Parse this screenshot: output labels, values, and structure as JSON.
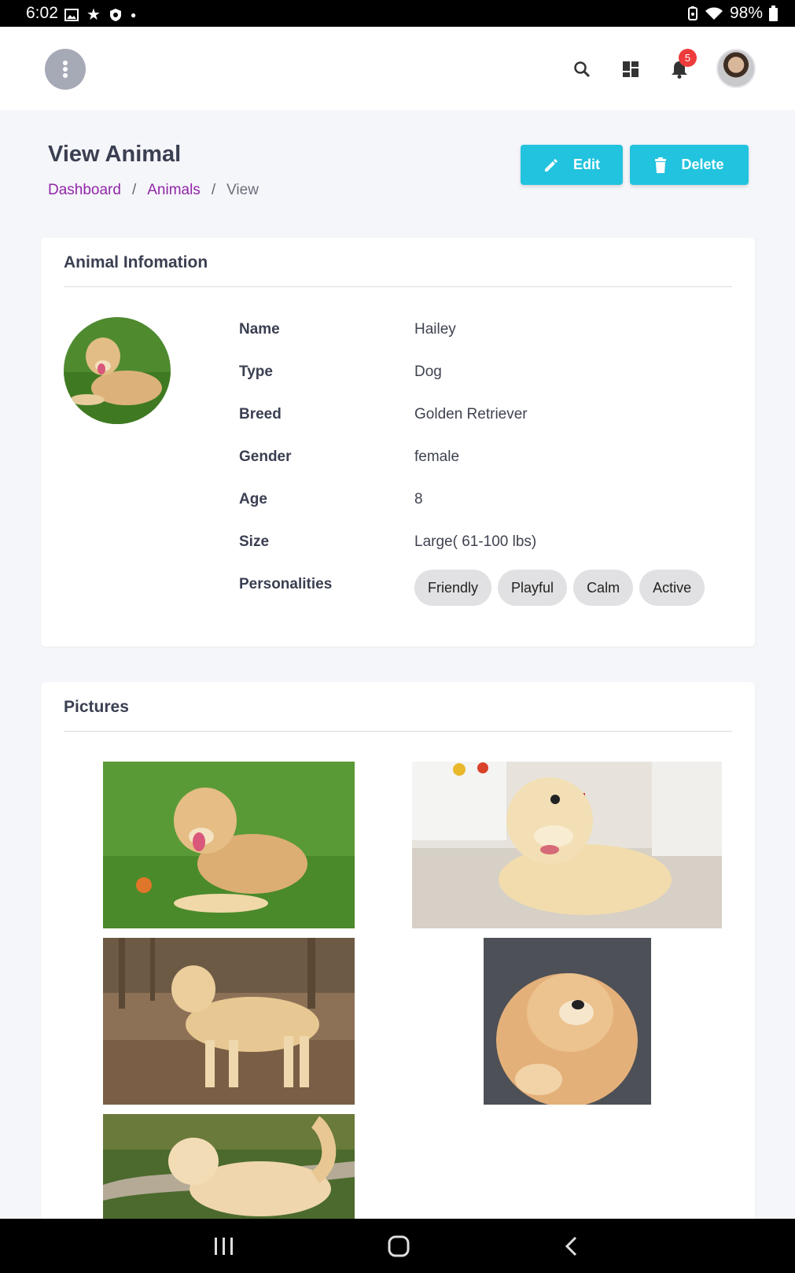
{
  "status_bar": {
    "time": "6:02",
    "battery": "98%"
  },
  "header": {
    "notification_count": "5"
  },
  "page": {
    "title": "View Animal",
    "breadcrumb": [
      {
        "label": "Dashboard"
      },
      {
        "label": "Animals"
      },
      {
        "label": "View"
      }
    ],
    "edit_label": "Edit",
    "delete_label": "Delete"
  },
  "animal_card": {
    "title": "Animal Infomation",
    "fields": [
      {
        "label": "Name",
        "value": "Hailey"
      },
      {
        "label": "Type",
        "value": "Dog"
      },
      {
        "label": "Breed",
        "value": "Golden Retriever"
      },
      {
        "label": "Gender",
        "value": "female"
      },
      {
        "label": "Age",
        "value": "8"
      },
      {
        "label": "Size",
        "value": "Large( 61-100 lbs)"
      }
    ],
    "personalities_label": "Personalities",
    "personalities": [
      "Friendly",
      "Playful",
      "Calm",
      "Active"
    ]
  },
  "pictures_card": {
    "title": "Pictures"
  },
  "colors": {
    "accent": "#22c3de",
    "link": "#9126a8",
    "badge": "#ee3b3b"
  }
}
